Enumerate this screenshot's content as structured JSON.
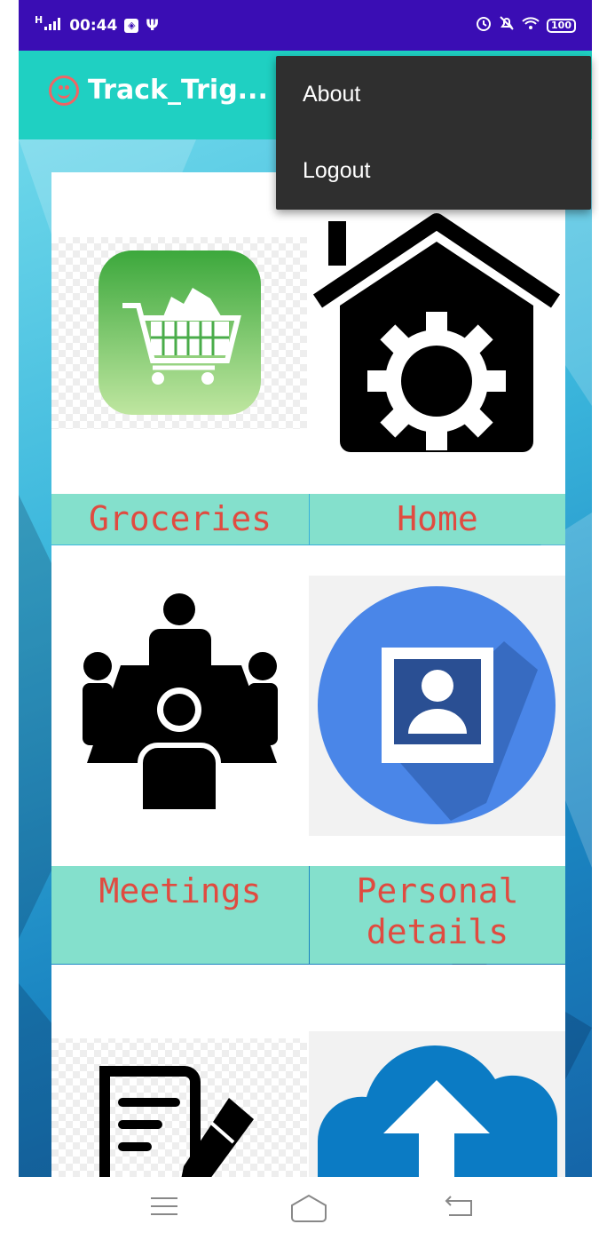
{
  "status_bar": {
    "signal": "H",
    "time": "00:44",
    "battery": "100"
  },
  "app_bar": {
    "title": "Track_Trig..."
  },
  "overflow_menu": {
    "items": [
      "About",
      "Logout"
    ]
  },
  "tiles": [
    {
      "label": "Groceries",
      "icon": "shopping-cart-icon"
    },
    {
      "label": "Home",
      "icon": "house-gear-icon"
    },
    {
      "label": "Meetings",
      "icon": "meeting-people-icon"
    },
    {
      "label": "Personal\ndetails",
      "icon": "profile-photo-icon"
    },
    {
      "label": "",
      "icon": "notes-pencil-icon"
    },
    {
      "label": "",
      "icon": "cloud-upload-icon"
    }
  ],
  "nav_bar": {
    "icons": [
      "menu-icon",
      "home-icon",
      "back-icon"
    ]
  },
  "colors": {
    "status_bar": "#3a0db4",
    "app_bar": "#1fd0c2",
    "label_bg": "#84e0cc",
    "label_text": "#e04b40",
    "menu_bg": "#2f2f2f"
  }
}
